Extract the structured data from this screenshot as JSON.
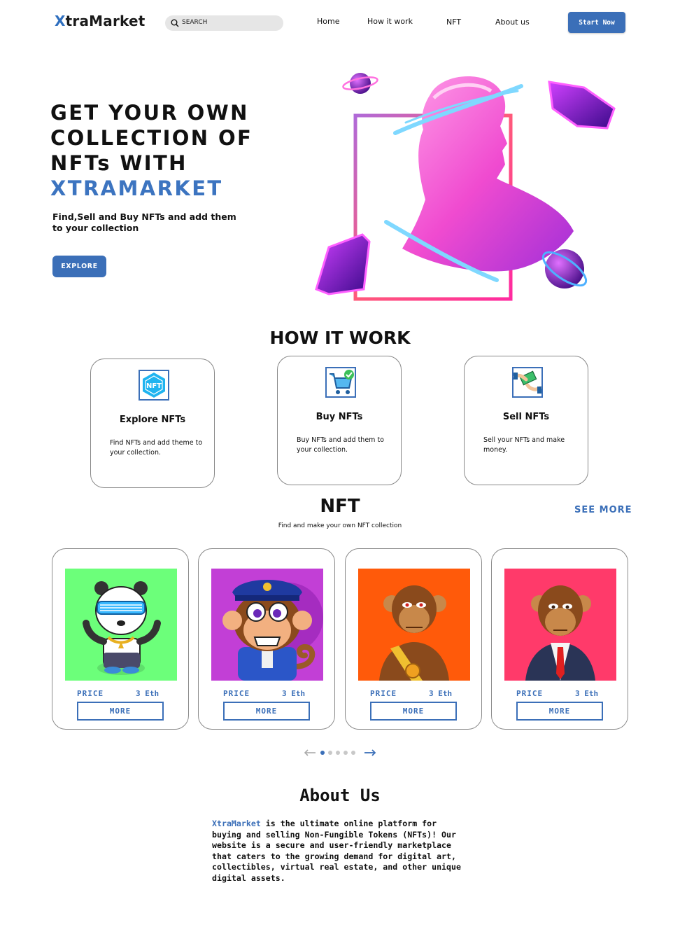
{
  "nav": {
    "logo_first": "X",
    "logo_rest": "traMarket",
    "search_placeholder": "SEARCH",
    "links": [
      "Home",
      "How it work",
      "NFT",
      "About us"
    ],
    "cta": "Start Now"
  },
  "hero": {
    "title_lines": [
      "GET YOUR OWN",
      "COLLECTION OF",
      "NFTs WITH"
    ],
    "title_brand": "XTRAMARKET",
    "subtitle": "Find,Sell and Buy NFTs and add them to your collection",
    "button": "EXPLORE"
  },
  "how": {
    "title": "HOW IT WORK",
    "cards": [
      {
        "icon": "nft-badge-icon",
        "title": "Explore NFTs",
        "desc": "Find NFTs and add theme to your collection."
      },
      {
        "icon": "shopping-cart-icon",
        "title": "Buy NFTs",
        "desc": "Buy NFTs and add them to your collection."
      },
      {
        "icon": "money-hand-icon",
        "title": "Sell NFTs",
        "desc": "Sell your NFTs and make money."
      }
    ]
  },
  "nft": {
    "title": "NFT",
    "subtitle": "Find and make your own NFT collection",
    "see_more": "SEE MORE",
    "cards": [
      {
        "price_label": "PRICE",
        "price": "3 Eth",
        "button": "MORE",
        "bg": "#6cff7a",
        "art": "panda-with-sunglasses"
      },
      {
        "price_label": "PRICE",
        "price": "3 Eth",
        "button": "MORE",
        "bg": "#c23fd6",
        "art": "police-monkey"
      },
      {
        "price_label": "PRICE",
        "price": "3 Eth",
        "button": "MORE",
        "bg": "#ff5a0a",
        "art": "ape-with-sash"
      },
      {
        "price_label": "PRICE",
        "price": "3 Eth",
        "button": "MORE",
        "bg": "#ff3a6a",
        "art": "ape-in-suit"
      }
    ],
    "pager": {
      "pages": 5,
      "active": 1
    }
  },
  "about": {
    "title": "About Us",
    "brand": "XtraMarket",
    "text": " is the ultimate online platform for buying and selling Non-Fungible Tokens (NFTs)! Our website is a secure and user-friendly marketplace that caters to the growing demand for digital art, collectibles, virtual real estate, and other unique digital assets."
  },
  "colors": {
    "accent": "#3b6fb8",
    "text": "#111111"
  }
}
